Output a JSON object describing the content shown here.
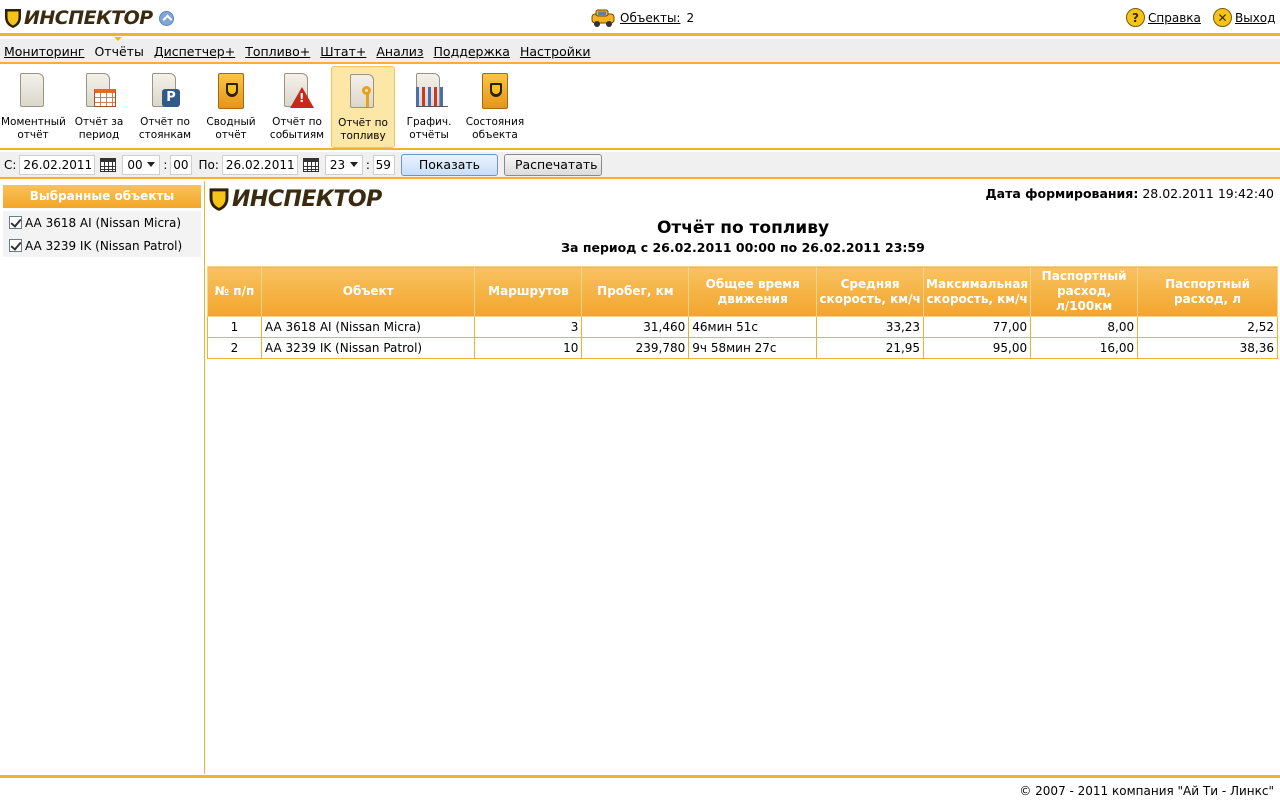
{
  "header": {
    "logo_text": "ИНСПЕКТОР",
    "objects_label": "Объекты:",
    "objects_count": "2",
    "help_label": "Справка",
    "exit_label": "Выход"
  },
  "menu": {
    "items": [
      {
        "label": "Мониторинг"
      },
      {
        "label": "Отчёты"
      },
      {
        "label": "Диспетчер+"
      },
      {
        "label": "Топливо+"
      },
      {
        "label": "Штат+"
      },
      {
        "label": "Анализ"
      },
      {
        "label": "Поддержка"
      },
      {
        "label": "Настройки"
      }
    ]
  },
  "toolbar": {
    "items": [
      {
        "line1": "Моментный",
        "line2": "отчёт",
        "icon": "document-icon"
      },
      {
        "line1": "Отчёт за",
        "line2": "период",
        "icon": "calendar-document-icon"
      },
      {
        "line1": "Отчёт по",
        "line2": "стоянкам",
        "icon": "parking-document-icon"
      },
      {
        "line1": "Сводный",
        "line2": "отчёт",
        "icon": "summary-folder-icon"
      },
      {
        "line1": "Отчёт по",
        "line2": "событиям",
        "icon": "warning-document-icon"
      },
      {
        "line1": "Отчёт по",
        "line2": "топливу",
        "icon": "fuel-keys-icon"
      },
      {
        "line1": "Графич.",
        "line2": "отчёты",
        "icon": "graph-document-icon"
      },
      {
        "line1": "Состояния",
        "line2": "объекта",
        "icon": "state-folder-icon"
      }
    ]
  },
  "filter": {
    "from_label": "С:",
    "from_date": "26.02.2011",
    "from_hour": "00",
    "from_min": "00",
    "to_label": "По:",
    "to_date": "26.02.2011",
    "to_hour": "23",
    "to_min": "59",
    "colon": ":",
    "show_label": "Показать",
    "print_label": "Распечатать"
  },
  "sidebar": {
    "title": "Выбранные объекты",
    "objects": [
      {
        "label": "AA 3618 AI (Nissan Micra)"
      },
      {
        "label": "AA 3239 IK (Nissan Patrol)"
      }
    ]
  },
  "report": {
    "logo_text": "ИНСПЕКТОР",
    "gen_label": "Дата формирования:",
    "gen_value": "28.02.2011 19:42:40",
    "title": "Отчёт по топливу",
    "subtitle": "За период с 26.02.2011 00:00 по 26.02.2011 23:59",
    "columns": [
      "№ п/п",
      "Объект",
      "Маршрутов",
      "Пробег, км",
      "Общее время движения",
      "Средняя скорость, км/ч",
      "Максимальная скорость, км/ч",
      "Паспортный расход, л/100км",
      "Паспортный расход, л"
    ],
    "rows": [
      [
        "1",
        "AA 3618 AI (Nissan Micra)",
        "3",
        "31,460",
        "46мин 51с",
        "33,23",
        "77,00",
        "8,00",
        "2,52"
      ],
      [
        "2",
        "AA 3239 IK (Nissan Patrol)",
        "10",
        "239,780",
        "9ч 58мин 27с",
        "21,95",
        "95,00",
        "16,00",
        "38,36"
      ]
    ]
  },
  "footer": {
    "copyright": "© 2007 - 2011 компания \"Ай Ти - Линкс\""
  },
  "colors": {
    "accent": "#f4b12e",
    "header_orange": "#f3a52c",
    "active_tool": "#fde7a6"
  }
}
